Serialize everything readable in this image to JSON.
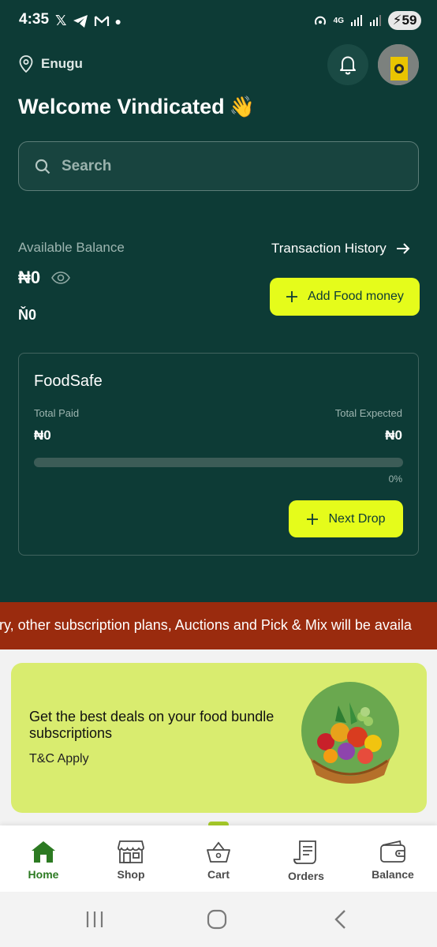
{
  "status_bar": {
    "time": "4:35",
    "battery": "59",
    "network": "4G"
  },
  "header": {
    "location": "Enugu",
    "welcome": "Welcome Vindicated",
    "wave_emoji": "👋"
  },
  "search": {
    "placeholder": "Search"
  },
  "balance": {
    "label": "Available Balance",
    "amount": "₦0",
    "secondary_amount": "Ň0",
    "transaction_history": "Transaction History",
    "add_money_label": "Add Food money"
  },
  "foodsafe": {
    "title": "FoodSafe",
    "total_paid_label": "Total Paid",
    "total_expected_label": "Total Expected",
    "total_paid": "₦0",
    "total_expected": "₦0",
    "progress_fraction": 0,
    "progress_text": "0%",
    "next_drop_label": "Next Drop"
  },
  "ticker": {
    "text": "very, other subscription plans, Auctions and Pick & Mix will be availa"
  },
  "promo": {
    "title": "Get the best deals on your food bundle subscriptions",
    "tc": "T&C Apply"
  },
  "bottom_nav": {
    "items": [
      {
        "label": "Home",
        "icon": "home-icon",
        "active": true
      },
      {
        "label": "Shop",
        "icon": "shop-icon"
      },
      {
        "label": "Cart",
        "icon": "cart-icon"
      },
      {
        "label": "Orders",
        "icon": "orders-icon"
      },
      {
        "label": "Balance",
        "icon": "wallet-icon"
      }
    ]
  },
  "colors": {
    "primary_dark": "#0d3b36",
    "accent": "#e5fc1b",
    "ticker_bg": "#9a2b0e",
    "promo_bg": "#d9ec6f",
    "active_nav": "#2c7a22"
  }
}
